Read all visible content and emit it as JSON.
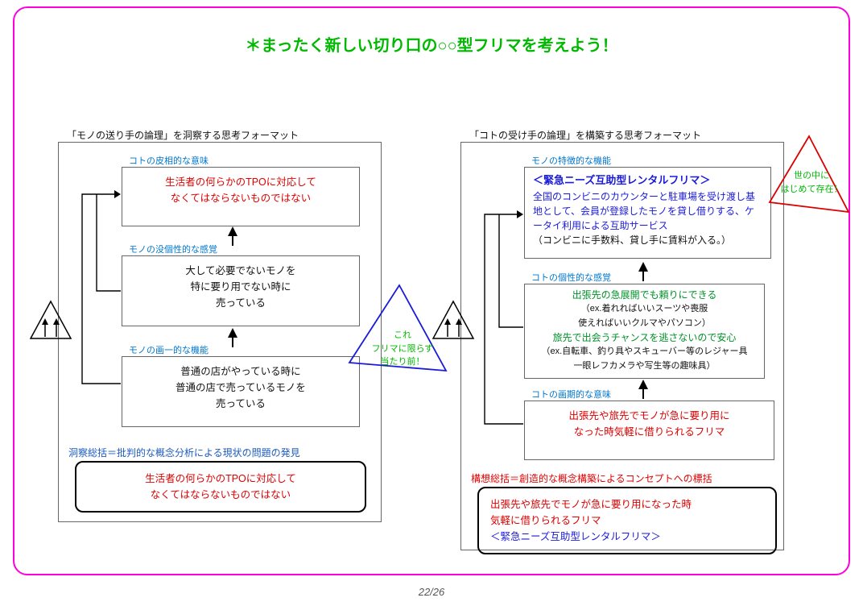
{
  "title": "＊まったく新しい切り口の○○型フリマを考えよう！",
  "page": "22/26",
  "left": {
    "panelTitle": "「モノの送り手の論理」を洞察する思考フォーマット",
    "box1": {
      "label": "コトの皮相的な意味",
      "l1": "生活者の何らかのTPOに対応して",
      "l2": "なくてはならないものではない"
    },
    "box2": {
      "label": "モノの没個性的な感覚",
      "l1": "大して必要でないモノを",
      "l2": "特に要り用でない時に",
      "l3": "売っている"
    },
    "box3": {
      "label": "モノの画一的な機能",
      "l1": "普通の店がやっている時に",
      "l2": "普通の店で売っているモノを",
      "l3": "売っている"
    },
    "sumLabel": "洞察総括＝批判的な概念分析による現状の問題の発見",
    "sum": {
      "l1": "生活者の何らかのTPOに対応して",
      "l2": "なくてはならないものではない"
    },
    "note": {
      "l1": "これ",
      "l2": "フリマに限らず",
      "l3": "当たり前！"
    }
  },
  "right": {
    "panelTitle": "「コトの受け手の論理」を構築する思考フォーマット",
    "box1": {
      "label": "モノの特徴的な機能",
      "title": "＜緊急ニーズ互助型レンタルフリマ＞",
      "body": "全国のコンビニのカウンターと駐車場を受け渡し基地として、会員が登録したモノを貸し借りする、ケータイ利用による互助サービス",
      "paren": "（コンビニに手数料、貸し手に賃料が入る。）"
    },
    "box2": {
      "label": "コトの個性的な感覚",
      "g1": "出張先の急展開でも頼りにできる",
      "e1a": "（ex.着れればいいスーツや喪服",
      "e1b": "使えればいいクルマやパソコン）",
      "g2": "旅先で出会うチャンスを逃さないので安心",
      "e2a": "（ex.自転車、釣り具やスキューバー等のレジャー具",
      "e2b": "一眼レフカメラや写生等の趣味具）"
    },
    "box3": {
      "label": "コトの画期的な意味",
      "l1": "出張先や旅先でモノが急に要り用に",
      "l2": "なった時気軽に借りられるフリマ"
    },
    "sumLabel": "構想総括＝創造的な概念構築によるコンセプトへの標括",
    "sum": {
      "l1": "出張先や旅先でモノが急に要り用になった時",
      "l2": "気軽に借りられるフリマ",
      "l3": "＜緊急ニーズ互助型レンタルフリマ＞"
    },
    "note": {
      "l1": "世の中に",
      "l2": "はじめて存在！"
    }
  }
}
